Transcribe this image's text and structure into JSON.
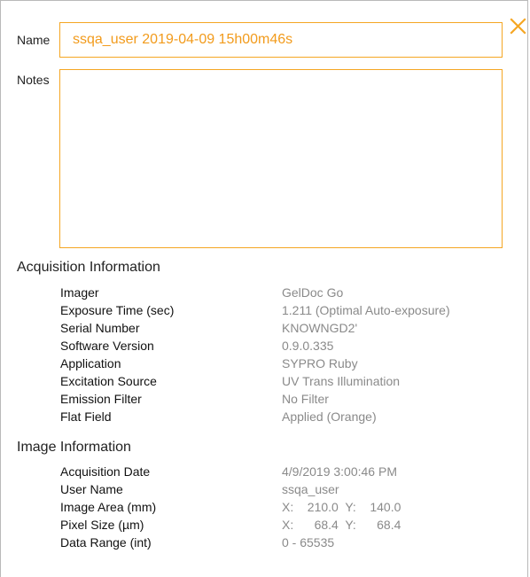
{
  "dialog": {
    "close_icon": "close-x-icon",
    "accent_color": "#f5a623"
  },
  "name_field": {
    "label": "Name",
    "value": "ssqa_user 2019-04-09 15h00m46s"
  },
  "notes_field": {
    "label": "Notes",
    "value": ""
  },
  "acquisition": {
    "title": "Acquisition Information",
    "rows": [
      {
        "key": "Imager",
        "value": "GelDoc Go"
      },
      {
        "key": "Exposure Time (sec)",
        "value": "1.211 (Optimal Auto-exposure)"
      },
      {
        "key": "Serial Number",
        "value": "KNOWNGD2'"
      },
      {
        "key": "Software Version",
        "value": "0.9.0.335"
      },
      {
        "key": "Application",
        "value": "SYPRO Ruby"
      },
      {
        "key": "Excitation Source",
        "value": "UV Trans Illumination"
      },
      {
        "key": "Emission Filter",
        "value": "No Filter"
      },
      {
        "key": "Flat Field",
        "value": "Applied (Orange)"
      }
    ]
  },
  "image_info": {
    "title": "Image Information",
    "rows": [
      {
        "key": "Acquisition Date",
        "value": "4/9/2019 3:00:46 PM"
      },
      {
        "key": "User Name",
        "value": "ssqa_user"
      },
      {
        "key": "Image Area (mm)",
        "value": "X:    210.0  Y:    140.0"
      },
      {
        "key": "Pixel Size (µm)",
        "value": "X:      68.4  Y:      68.4"
      },
      {
        "key": "Data Range (int)",
        "value": "0 - 65535"
      }
    ]
  }
}
